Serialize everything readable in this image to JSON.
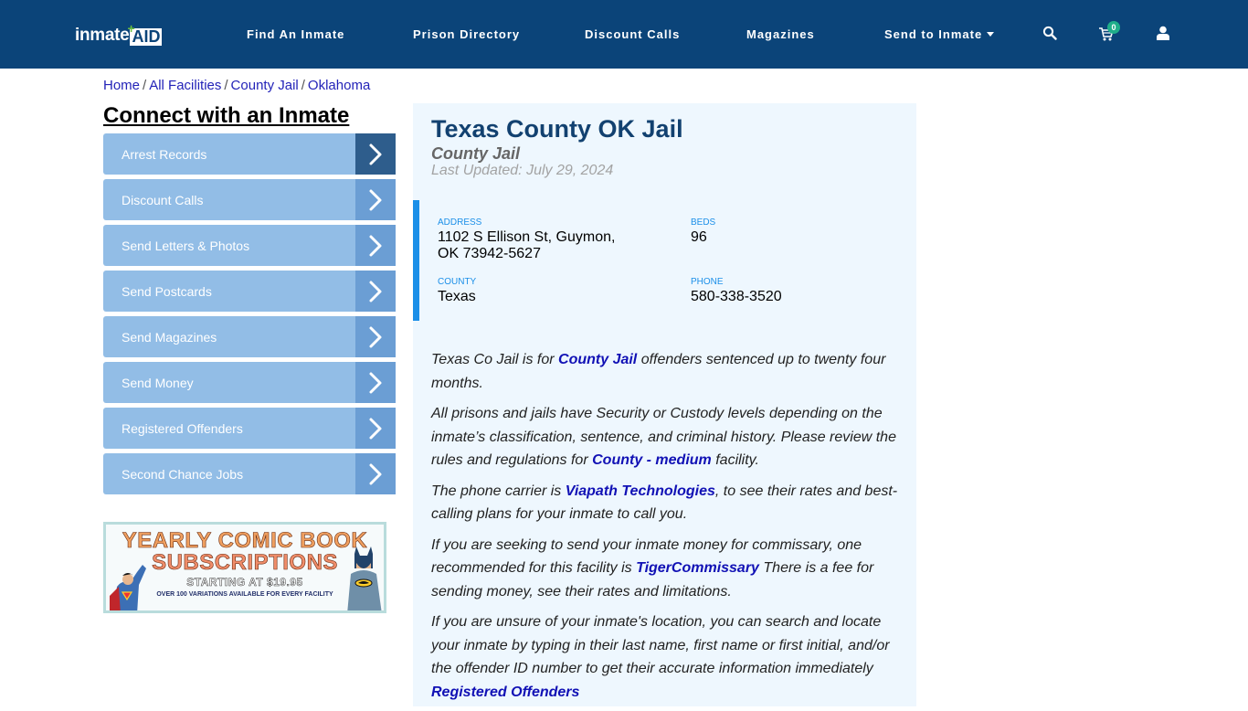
{
  "header": {
    "logo": {
      "part1": "inmate",
      "part2": "AID",
      "plus": "+"
    },
    "nav": [
      {
        "label": "Find An Inmate"
      },
      {
        "label": "Prison Directory"
      },
      {
        "label": "Discount Calls"
      },
      {
        "label": "Magazines"
      },
      {
        "label": "Send to Inmate",
        "has_dropdown": true
      }
    ],
    "icons": {
      "search": "search-icon",
      "cart": "cart-icon",
      "user": "user-icon"
    },
    "cart_count": "0"
  },
  "breadcrumb": [
    {
      "label": "Home"
    },
    {
      "label": "All Facilities"
    },
    {
      "label": "County Jail"
    },
    {
      "label": "Oklahoma"
    }
  ],
  "breadcrumb_sep": "/",
  "sidebar": {
    "title": "Connect with an Inmate",
    "items": [
      {
        "label": "Arrest Records",
        "active": true
      },
      {
        "label": "Discount Calls"
      },
      {
        "label": "Send Letters & Photos"
      },
      {
        "label": "Send Postcards"
      },
      {
        "label": "Send Magazines"
      },
      {
        "label": "Send Money"
      },
      {
        "label": "Registered Offenders"
      },
      {
        "label": "Second Chance Jobs"
      }
    ],
    "banner": {
      "line1": "YEARLY COMIC BOOK",
      "line2": "SUBSCRIPTIONS",
      "line3": "STARTING AT $19.95",
      "line4": "OVER 100 VARIATIONS AVAILABLE FOR EVERY FACILITY"
    }
  },
  "facility": {
    "name": "Texas County OK Jail",
    "type": "County Jail",
    "last_updated": "Last Updated: July 29, 2024",
    "address_label": "ADDRESS",
    "address_line1": "1102 S Ellison St, Guymon,",
    "address_line2": "OK 73942-5627",
    "beds_label": "BEDS",
    "beds": "96",
    "county_label": "COUNTY",
    "county": "Texas",
    "phone_label": "PHONE",
    "phone": "580-338-3520"
  },
  "content": {
    "p1": {
      "pre": "Texas Co Jail is for ",
      "link": "County Jail",
      "post": " offenders sentenced up to twenty four months."
    },
    "p2": {
      "pre": "All prisons and jails have Security or Custody levels depending on the inmate’s classification, sentence, and criminal history. Please review the rules and regulations for ",
      "link": "County - medium",
      "post": " facility."
    },
    "p3": {
      "pre": "The phone carrier is ",
      "link": "Viapath Technologies",
      "post": ", to see their rates and best-calling plans for your inmate to call you."
    },
    "p4": {
      "pre": "If you are seeking to send your inmate money for commissary, one recommended for this facility is ",
      "link": "TigerCommissary",
      "post": " There is a fee for sending money, see their rates and limitations."
    },
    "p5": {
      "pre": "If you are unsure of your inmate's location, you can search and locate your inmate by typing in their last name, first name or first initial, and/or the offender ID number to get their accurate information immediately ",
      "link": "Registered Offenders",
      "post": ""
    }
  }
}
